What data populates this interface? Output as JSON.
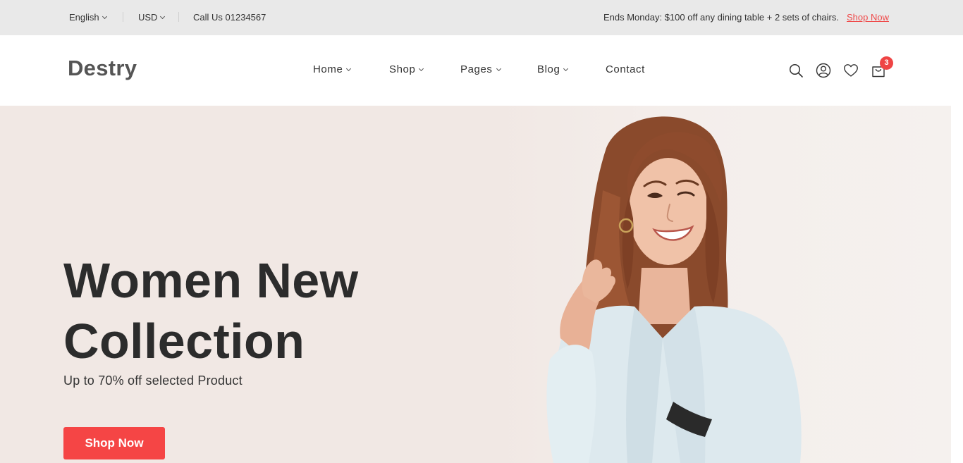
{
  "topbar": {
    "language": "English",
    "currency": "USD",
    "phone": "Call Us 01234567",
    "promo": "Ends Monday: $100 off any dining table + 2 sets of chairs.",
    "promo_link": "Shop Now"
  },
  "header": {
    "logo": "Destry",
    "nav": [
      {
        "label": "Home"
      },
      {
        "label": "Shop"
      },
      {
        "label": "Pages"
      },
      {
        "label": "Blog"
      },
      {
        "label": "Contact"
      }
    ],
    "icons": [
      "search-icon",
      "user-icon",
      "heart-icon",
      "cart-icon"
    ],
    "cart_count": "3"
  },
  "hero": {
    "title_line1": "Women New",
    "title_line2": "Collection",
    "subtitle": "Up to 70% off selected Product",
    "button": "Shop Now"
  },
  "colors": {
    "accent": "#f54545",
    "hero_bg": "#f1e8e4",
    "topbar_bg": "#e9e9e9",
    "text_dark": "#2c2c2c"
  }
}
